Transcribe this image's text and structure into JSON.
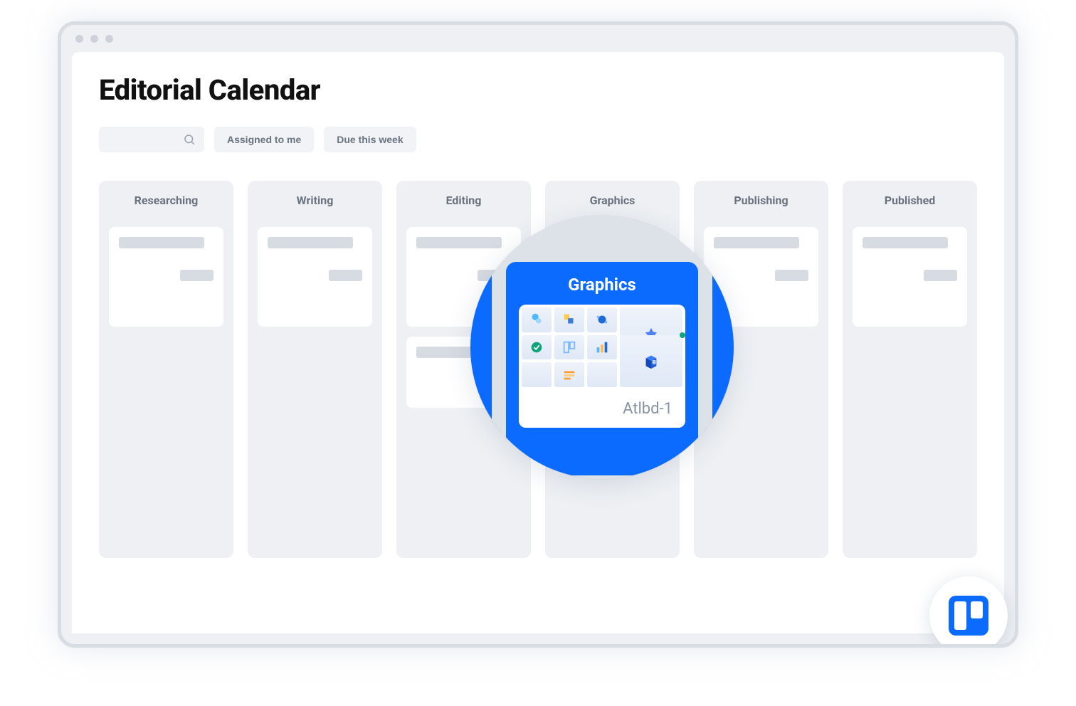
{
  "header": {
    "title": "Editorial Calendar"
  },
  "toolbar": {
    "filters": [
      {
        "label": "Assigned to me"
      },
      {
        "label": "Due this week"
      }
    ]
  },
  "board": {
    "columns": [
      {
        "title": "Researching"
      },
      {
        "title": "Writing"
      },
      {
        "title": "Editing"
      },
      {
        "title": "Graphics"
      },
      {
        "title": "Publishing"
      },
      {
        "title": "Published"
      }
    ]
  },
  "magnifier": {
    "column_title": "Graphics",
    "card_label": "Atlbd-1"
  },
  "app_badge": {
    "name": "trello"
  }
}
